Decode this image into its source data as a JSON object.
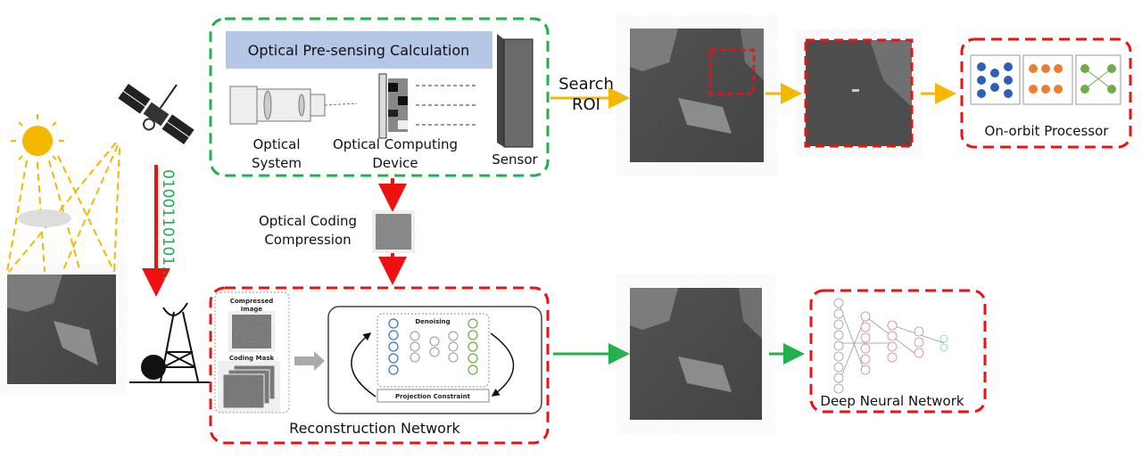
{
  "presensing": {
    "title": "Optical Pre-sensing Calculation",
    "optical_system": [
      "Optical",
      "System"
    ],
    "optical_computing_device": [
      "Optical Computing",
      "Device"
    ],
    "sensor": "Sensor"
  },
  "search_roi": [
    "Search",
    "ROI"
  ],
  "onorbit_processor": "On-orbit Processor",
  "coding_compression": [
    "Optical Coding",
    "Compression"
  ],
  "binary_stream": "0100110101...",
  "reconstruction": {
    "title": "Reconstruction Network",
    "compressed_image": [
      "Compressed",
      "Image"
    ],
    "coding_mask": "Coding Mask",
    "denoising": "Denoising",
    "projection_constraint": "Projection Constraint"
  },
  "dnn": "Deep Neural Network",
  "colors": {
    "green_box": "#22b04a",
    "red_box": "#ee1111",
    "yellow_arrow": "#f5b800",
    "blue_bar": "#b4c7e7",
    "binary_text": "#22aa55"
  }
}
